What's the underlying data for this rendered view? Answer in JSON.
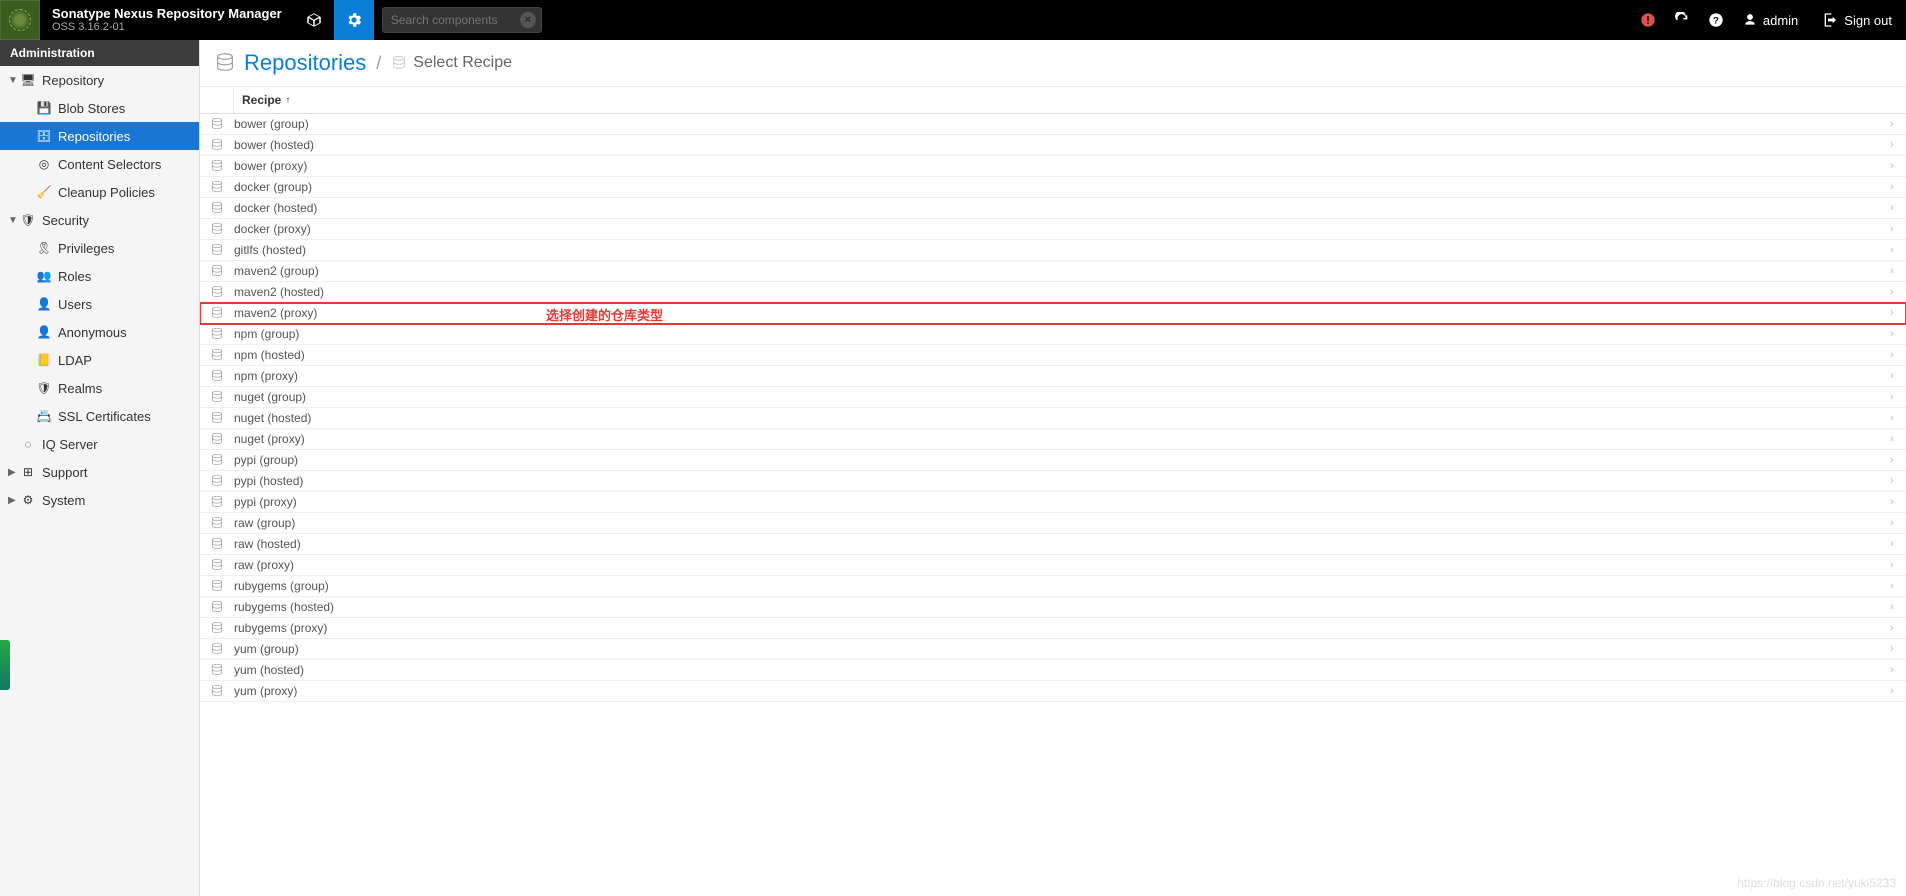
{
  "header": {
    "brand_title": "Sonatype Nexus Repository Manager",
    "brand_sub": "OSS 3.16.2-01",
    "search_placeholder": "Search components",
    "user": "admin",
    "signout": "Sign out"
  },
  "sidebar": {
    "title": "Administration",
    "groups": [
      {
        "label": "Repository",
        "expanded": true,
        "icon": "server",
        "items": [
          {
            "label": "Blob Stores",
            "icon": "hdd"
          },
          {
            "label": "Repositories",
            "icon": "db",
            "active": true
          },
          {
            "label": "Content Selectors",
            "icon": "target"
          },
          {
            "label": "Cleanup Policies",
            "icon": "broom"
          }
        ]
      },
      {
        "label": "Security",
        "expanded": true,
        "icon": "shield",
        "items": [
          {
            "label": "Privileges",
            "icon": "ribbon"
          },
          {
            "label": "Roles",
            "icon": "users"
          },
          {
            "label": "Users",
            "icon": "usergroup"
          },
          {
            "label": "Anonymous",
            "icon": "person"
          },
          {
            "label": "LDAP",
            "icon": "book"
          },
          {
            "label": "Realms",
            "icon": "badge"
          },
          {
            "label": "SSL Certificates",
            "icon": "cert"
          }
        ]
      },
      {
        "label": "IQ Server",
        "expanded": false,
        "icon": "iq",
        "leaf": true
      },
      {
        "label": "Support",
        "expanded": false,
        "icon": "life"
      },
      {
        "label": "System",
        "expanded": false,
        "icon": "gears"
      }
    ]
  },
  "breadcrumb": {
    "title": "Repositories",
    "sub": "Select Recipe"
  },
  "table": {
    "header": "Recipe",
    "rows": [
      "bower (group)",
      "bower (hosted)",
      "bower (proxy)",
      "docker (group)",
      "docker (hosted)",
      "docker (proxy)",
      "gitlfs (hosted)",
      "maven2 (group)",
      "maven2 (hosted)",
      "maven2 (proxy)",
      "npm (group)",
      "npm (hosted)",
      "npm (proxy)",
      "nuget (group)",
      "nuget (hosted)",
      "nuget (proxy)",
      "pypi (group)",
      "pypi (hosted)",
      "pypi (proxy)",
      "raw (group)",
      "raw (hosted)",
      "raw (proxy)",
      "rubygems (group)",
      "rubygems (hosted)",
      "rubygems (proxy)",
      "yum (group)",
      "yum (hosted)",
      "yum (proxy)"
    ],
    "highlight_index": 9,
    "annotation": "选择创建的仓库类型"
  },
  "watermark": "https://blog.csdn.net/yuki5233"
}
